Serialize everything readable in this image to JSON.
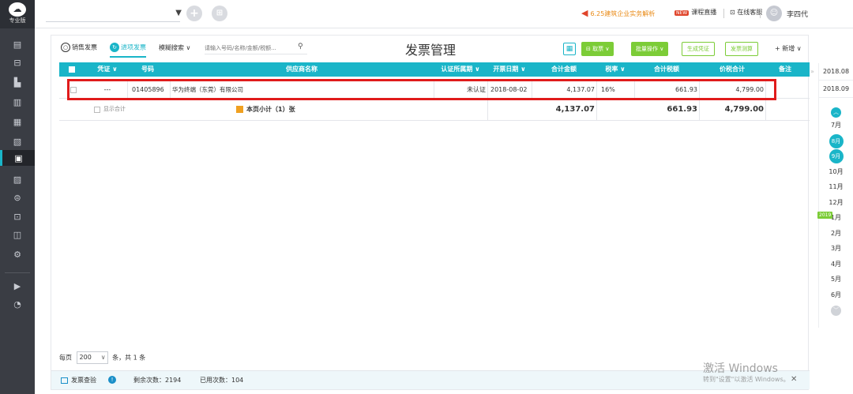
{
  "sidebar": {
    "logo_edition": "专业版",
    "icons": [
      "dashboard-icon",
      "voucher-icon",
      "chart-icon",
      "ledger-icon",
      "report-icon",
      "book-icon",
      "invoice-icon",
      "asset-icon",
      "salary-icon",
      "tax-icon",
      "check-icon",
      "settings-icon",
      "play-icon",
      "speed-icon"
    ]
  },
  "topbar": {
    "promo": "6.25建筑企业实务解析",
    "live_badge": "NEW",
    "live": "课程直播",
    "service": "在线客服",
    "user": "李四代"
  },
  "toolbar": {
    "tab_sales": "销售发票",
    "tab_purchase": "进项发票",
    "fuzzy": "模糊搜索 ∨",
    "search_placeholder": "请输入号码/名称/金额/税额...",
    "title": "发票管理",
    "btn_fetch": "取票 ∨",
    "btn_batch": "批量操作 ∨",
    "btn_voucher": "生成凭证",
    "btn_calc": "发票测算",
    "btn_add": "+ 新增 ∨"
  },
  "table": {
    "headers": {
      "voucher": "凭证 ∨",
      "number": "号码",
      "supplier": "供应商名称",
      "period": "认证所属期 ∨",
      "date": "开票日期 ∨",
      "amount": "合计金额",
      "rate": "税率 ∨",
      "tax": "合计税额",
      "total": "价税合计",
      "remark": "备注"
    },
    "rows": [
      {
        "voucher": "---",
        "number": "01405896",
        "supplier": "华为终端（东莞）有限公司",
        "period": "未认证",
        "date": "2018-08-02",
        "amount": "4,137.07",
        "rate": "16%",
        "tax": "661.93",
        "total": "4,799.00",
        "remark": ""
      }
    ],
    "subtotal": {
      "show_total": "显示合计",
      "page_label": "本页小计（1）张",
      "amount": "4,137.07",
      "tax": "661.93",
      "total": "4,799.00"
    }
  },
  "pager": {
    "per_page": "每页",
    "size": "200",
    "unit": "条，共 1 条"
  },
  "footer": {
    "check": "发票查验",
    "remaining": "剩余次数：2194",
    "used": "已用次数：104"
  },
  "watermark": {
    "line1": "激活 Windows",
    "line2": "转到\"设置\"以激活 Windows。"
  },
  "timeline": {
    "years": [
      "2018.08",
      "2018.09"
    ],
    "months": [
      "7月",
      "8月",
      "9月",
      "10月",
      "11月",
      "12月",
      "1月",
      "2月",
      "3月",
      "4月",
      "5月",
      "6月"
    ],
    "year_badge": "2019",
    "selected_months": [
      "8月",
      "9月"
    ]
  },
  "colors": {
    "accent": "#1ab5c8",
    "green": "#7ccc37",
    "highlight_red": "#e01b1b",
    "sidebar": "#3a3d44"
  }
}
